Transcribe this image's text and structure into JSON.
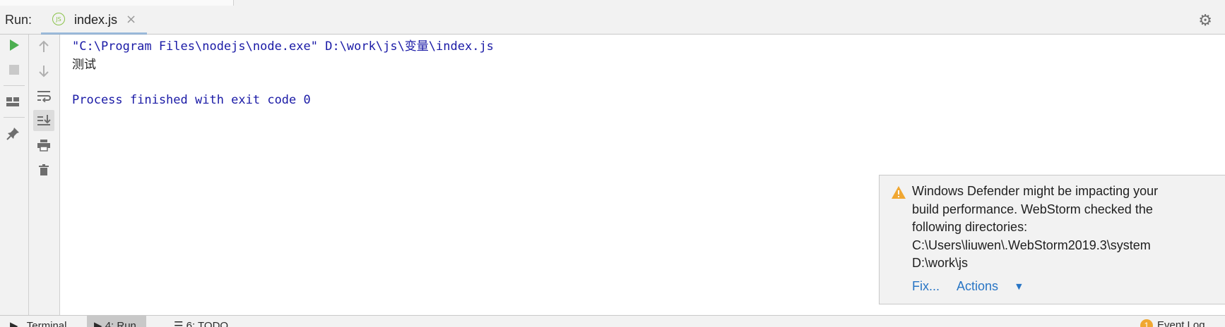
{
  "header": {
    "run_label": "Run:",
    "tab_title": "index.js",
    "tab_icon": "nodejs-file-icon",
    "tab_icon_text": "JS",
    "close_glyph": "×"
  },
  "console": {
    "command_line": "\"C:\\Program Files\\nodejs\\node.exe\" D:\\work\\js\\变量\\index.js",
    "output_line": "测试",
    "exit_line": "Process finished with exit code 0"
  },
  "notification": {
    "message_lines": [
      "Windows Defender might be impacting your",
      "build performance. WebStorm checked the",
      "following directories:",
      "C:\\Users\\liuwen\\.WebStorm2019.3\\system",
      "D:\\work\\js"
    ],
    "fix_label": "Fix...",
    "actions_label": "Actions"
  },
  "bottom_bar": {
    "terminal_label": "Terminal",
    "run_label": "4: Run",
    "todo_label": "6: TODO",
    "event_log_label": "Event Log",
    "event_count": "1"
  },
  "colors": {
    "console_blue": "#1a1aa6",
    "run_green": "#4caf50",
    "link_blue": "#2875c5",
    "warning_orange": "#f0a732"
  }
}
